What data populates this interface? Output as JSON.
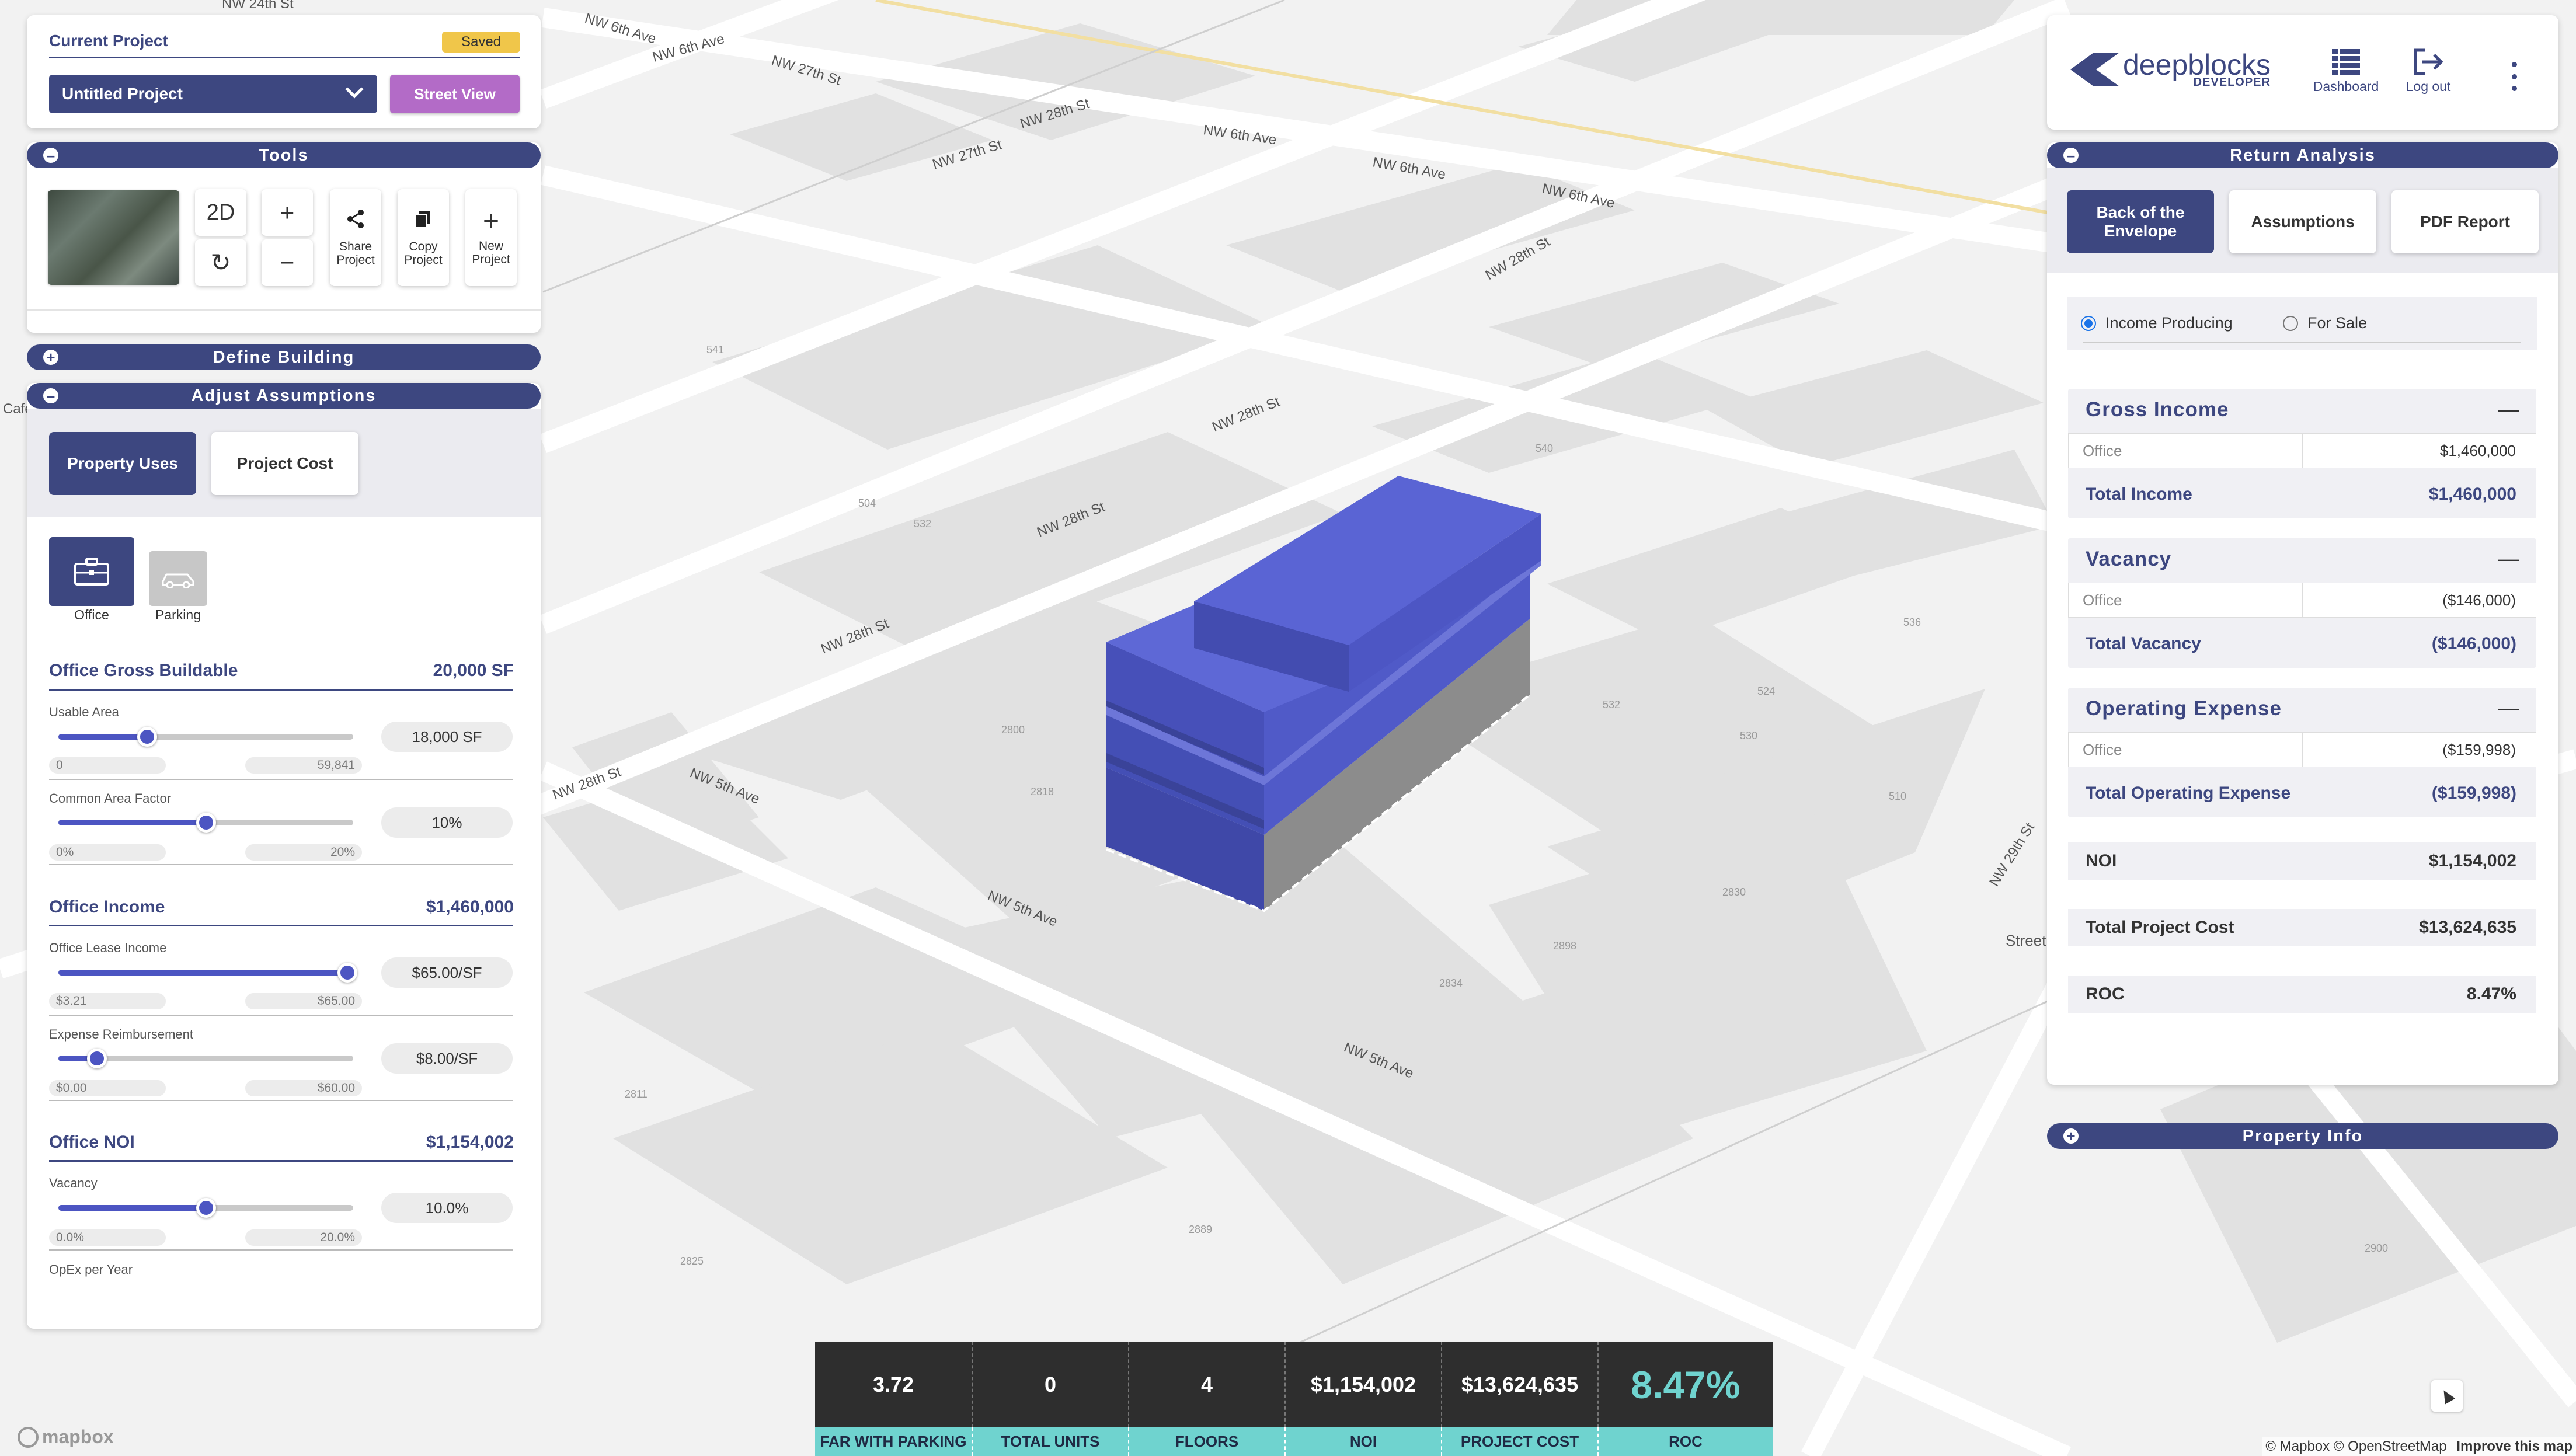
{
  "colors": {
    "accent": "#3d4780",
    "building": "#4c55c2",
    "street_view": "#b36bc7",
    "saved_badge": "#f0c64a",
    "stats_label": "#6fd3cf"
  },
  "map": {
    "streets": [
      "NW 24th St",
      "NW 6th Ave",
      "NW 6th Ave",
      "NW 27th St",
      "NW 27th St",
      "NW 28th St",
      "NW 28th St",
      "NW 28th St",
      "NW 28th St",
      "NW 5th Ave",
      "NW 5th Ave",
      "NW 5th Ave",
      "NW 29th St",
      "NW 6th Ave",
      "NW 28th St",
      "NW 6th Ave",
      "NW 6th Ave",
      "NW 28th St"
    ],
    "cafe_label": "Cafe",
    "street_label": "Street",
    "parcels": [
      "2800",
      "2818",
      "2811",
      "2825",
      "2889",
      "2834",
      "2898",
      "2900",
      "2830",
      "510",
      "530",
      "532",
      "536",
      "541",
      "504",
      "532",
      "540",
      "524"
    ],
    "logo": "mapbox",
    "attribution": "© Mapbox © OpenStreetMap",
    "improve": "Improve this map"
  },
  "project": {
    "title": "Current Project",
    "badge": "Saved",
    "name": "Untitled Project",
    "street_view": "Street View"
  },
  "tools": {
    "title": "Tools",
    "toggle": "–",
    "btn_2d": "2D",
    "zoom_in": "+",
    "zoom_out": "−",
    "rotate": "↻",
    "share": [
      "Share",
      "Project"
    ],
    "copy": [
      "Copy",
      "Project"
    ],
    "new": [
      "New",
      "Project"
    ],
    "share_icon": "share-icon",
    "copy_icon": "copy-icon",
    "new_icon": "plus-icon"
  },
  "define_building": {
    "title": "Define Building",
    "toggle": "+"
  },
  "assumptions": {
    "title": "Adjust Assumptions",
    "toggle": "–",
    "tabs": [
      "Property Uses",
      "Project Cost"
    ],
    "uses": [
      {
        "label": "Office",
        "icon": "briefcase-icon"
      },
      {
        "label": "Parking",
        "icon": "car-icon"
      }
    ],
    "sections": [
      {
        "title": "Office Gross Buildable",
        "value": "20,000 SF",
        "sliders": [
          {
            "label": "Usable Area",
            "value": "18,000 SF",
            "min": "0",
            "max": "59,841",
            "fraction": 0.3
          },
          {
            "label": "Common Area Factor",
            "value": "10%",
            "min": "0%",
            "max": "20%",
            "fraction": 0.5
          }
        ]
      },
      {
        "title": "Office Income",
        "value": "$1,460,000",
        "sliders": [
          {
            "label": "Office Lease Income",
            "value": "$65.00/SF",
            "min": "$3.21",
            "max": "$65.00",
            "fraction": 1.0
          },
          {
            "label": "Expense Reimbursement",
            "value": "$8.00/SF",
            "min": "$0.00",
            "max": "$60.00",
            "fraction": 0.13
          }
        ]
      },
      {
        "title": "Office NOI",
        "value": "$1,154,002",
        "sliders": [
          {
            "label": "Vacancy",
            "value": "10.0%",
            "min": "0.0%",
            "max": "20.0%",
            "fraction": 0.5
          }
        ]
      }
    ],
    "partial_label": "OpEx per Year"
  },
  "header": {
    "brand": "deepblocks",
    "brand_sub": "DEVELOPER",
    "dashboard": "Dashboard",
    "logout": "Log out",
    "menu_icon": "kebab-menu-icon"
  },
  "return_analysis": {
    "title": "Return Analysis",
    "toggle": "–",
    "tabs": [
      "Back of the Envelope",
      "Assumptions",
      "PDF Report"
    ],
    "radio": [
      "Income Producing",
      "For Sale"
    ],
    "gross_income": {
      "title": "Gross Income",
      "row_label": "Office",
      "row_value": "$1,460,000",
      "total_label": "Total Income",
      "total_value": "$1,460,000"
    },
    "vacancy": {
      "title": "Vacancy",
      "row_label": "Office",
      "row_value": "($146,000)",
      "total_label": "Total Vacancy",
      "total_value": "($146,000)"
    },
    "opex": {
      "title": "Operating Expense",
      "row_label": "Office",
      "row_value": "($159,998)",
      "total_label": "Total Operating Expense",
      "total_value": "($159,998)"
    },
    "noi": {
      "label": "NOI",
      "value": "$1,154,002"
    },
    "total_cost": {
      "label": "Total Project Cost",
      "value": "$13,624,635"
    },
    "roc": {
      "label": "ROC",
      "value": "8.47%"
    },
    "collapse": "—"
  },
  "property_info": {
    "title": "Property Info",
    "toggle": "+"
  },
  "stats": [
    {
      "value": "3.72",
      "label": "FAR WITH PARKING"
    },
    {
      "value": "0",
      "label": "TOTAL UNITS"
    },
    {
      "value": "4",
      "label": "FLOORS"
    },
    {
      "value": "$1,154,002",
      "label": "NOI"
    },
    {
      "value": "$13,624,635",
      "label": "PROJECT COST"
    },
    {
      "value": "8.47%",
      "label": "ROC"
    }
  ],
  "compass_icon": "compass-icon"
}
